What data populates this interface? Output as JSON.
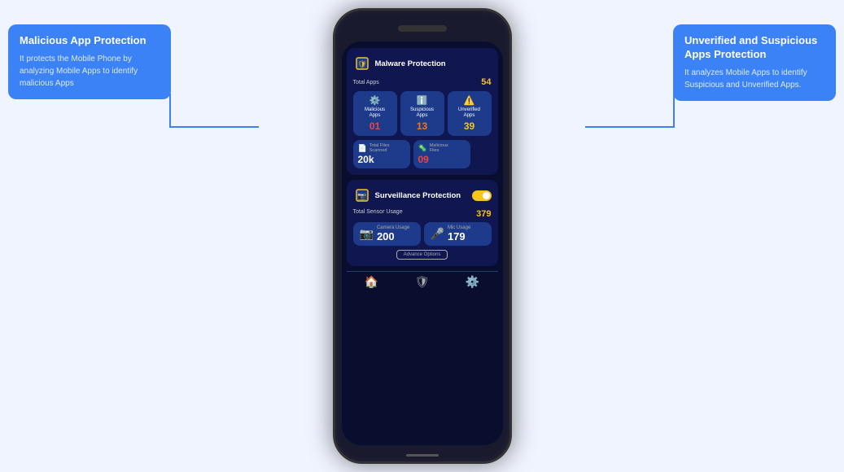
{
  "tooltipLeft": {
    "title": "Malicious App Protection",
    "text": "It protects the Mobile Phone by analyzing Mobile Apps to identify malicious Apps"
  },
  "tooltipRight": {
    "title": "Unverified and Suspicious Apps Protection",
    "text": "It analyzes Mobile Apps to identify Suspicious and Unverified Apps."
  },
  "malwareCard": {
    "title": "Malware Protection",
    "totalLabel": "Total Apps",
    "totalValue": "54",
    "maliciousLabel": "Malicious\nApps",
    "maliciousValue": "01",
    "suspiciousLabel": "Suspicious\nApps",
    "suspiciousValue": "13",
    "unverifiedLabel": "Unverified\nApps",
    "unverifiedValue": "39",
    "filesScannedLabel": "Total Files\nScanned",
    "filesScannedValue": "20k",
    "maliciousFilesLabel": "Malicious\nFiles",
    "maliciousFilesValue": "09"
  },
  "surveillanceCard": {
    "title": "Surveillance Protection",
    "totalSensorLabel": "Total Sensor Usage",
    "totalSensorValue": "379",
    "cameraLabel": "Camera Usage",
    "cameraValue": "200",
    "micLabel": "Mic Usage",
    "micValue": "179",
    "advanceBtnLabel": "Advance Options"
  }
}
